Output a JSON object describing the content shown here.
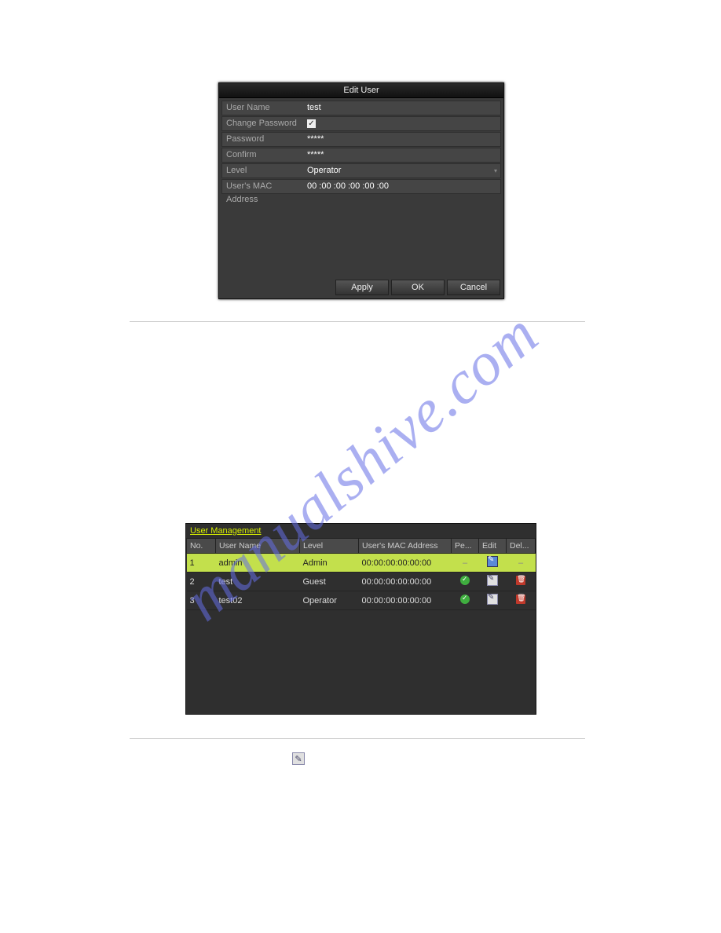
{
  "watermark": "manualshive.com",
  "dialog": {
    "title": "Edit User",
    "fields": {
      "user_name_label": "User Name",
      "user_name_value": "test",
      "change_pw_label": "Change Password",
      "change_pw_checked": "✓",
      "password_label": "Password",
      "password_value": "*****",
      "confirm_label": "Confirm",
      "confirm_value": "*****",
      "level_label": "Level",
      "level_value": "Operator",
      "mac_label": "User's MAC Address",
      "mac_value": "00 :00 :00 :00 :00 :00"
    },
    "buttons": {
      "apply": "Apply",
      "ok": "OK",
      "cancel": "Cancel"
    }
  },
  "panel": {
    "title": "User Management",
    "headers": {
      "no": "No.",
      "user_name": "User Name",
      "level": "Level",
      "mac": "User's MAC Address",
      "pe": "Pe...",
      "edit": "Edit",
      "del": "Del..."
    },
    "rows": [
      {
        "no": "1",
        "name": "admin",
        "level": "Admin",
        "mac": "00:00:00:00:00:00",
        "selected": true,
        "pe": "dash",
        "edit": "blue",
        "del": "dash"
      },
      {
        "no": "2",
        "name": "test",
        "level": "Guest",
        "mac": "00:00:00:00:00:00",
        "selected": false,
        "pe": "check",
        "edit": "edit",
        "del": "del"
      },
      {
        "no": "3",
        "name": "test02",
        "level": "Operator",
        "mac": "00:00:00:00:00:00",
        "selected": false,
        "pe": "check",
        "edit": "edit",
        "del": "del"
      }
    ]
  }
}
